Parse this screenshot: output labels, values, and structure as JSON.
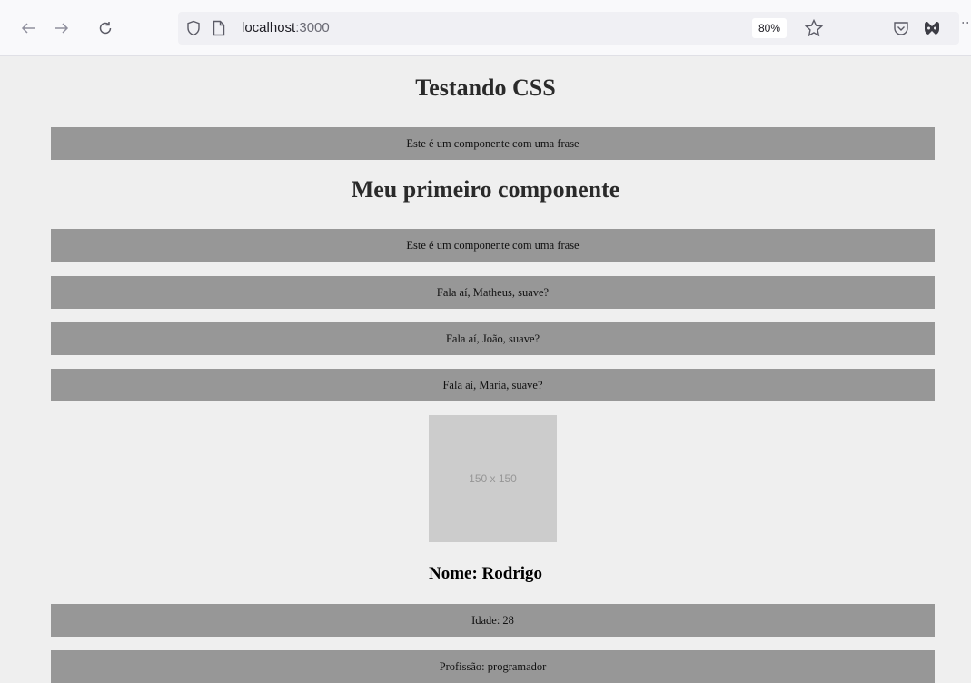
{
  "browser": {
    "back_icon": "arrow-left-icon",
    "forward_icon": "arrow-right-icon",
    "reload_icon": "reload-icon",
    "url_host": "localhost",
    "url_port": ":3000",
    "zoom": "80%"
  },
  "page": {
    "heading1": "Testando CSS",
    "phrase1": "Este é um componente com uma frase",
    "heading2": "Meu primeiro componente",
    "phrase2": "Este é um componente com uma frase",
    "greetings": [
      "Fala aí, Matheus, suave?",
      "Fala aí, João, suave?",
      "Fala aí, Maria, suave?"
    ],
    "image_placeholder": "150 x 150",
    "name": "Nome: Rodrigo",
    "age": "Idade: 28",
    "profession": "Profissão: programador"
  },
  "colors": {
    "page_bg": "#efefef",
    "bar_bg": "#979797",
    "placeholder_bg": "#cccccc"
  }
}
